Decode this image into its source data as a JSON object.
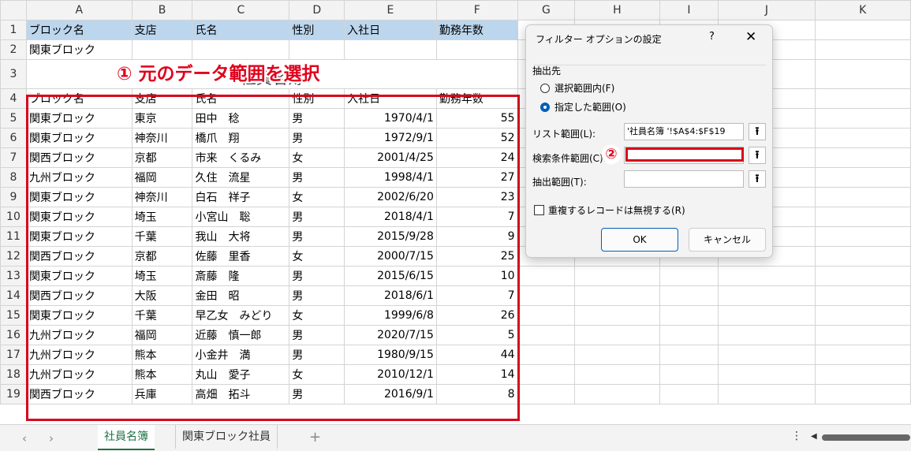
{
  "columns": [
    "A",
    "B",
    "C",
    "D",
    "E",
    "F",
    "G",
    "H",
    "I",
    "J",
    "K"
  ],
  "header_row1": [
    "ブロック名",
    "支店",
    "氏名",
    "性別",
    "入社日",
    "勤務年数"
  ],
  "row2_a": "関東ブロック",
  "title": "社員名簿",
  "header_row4": [
    "ブロック名",
    "支店",
    "氏名",
    "性別",
    "入社日",
    "勤務年数"
  ],
  "data_rows": [
    {
      "n": "5",
      "a": "関東ブロック",
      "b": "東京",
      "c": "田中　稔",
      "d": "男",
      "e": "1970/4/1",
      "f": "55"
    },
    {
      "n": "6",
      "a": "関東ブロック",
      "b": "神奈川",
      "c": "橋爪　翔",
      "d": "男",
      "e": "1972/9/1",
      "f": "52"
    },
    {
      "n": "7",
      "a": "関西ブロック",
      "b": "京都",
      "c": "市来　くるみ",
      "d": "女",
      "e": "2001/4/25",
      "f": "24"
    },
    {
      "n": "8",
      "a": "九州ブロック",
      "b": "福岡",
      "c": "久住　流星",
      "d": "男",
      "e": "1998/4/1",
      "f": "27"
    },
    {
      "n": "9",
      "a": "関東ブロック",
      "b": "神奈川",
      "c": "白石　祥子",
      "d": "女",
      "e": "2002/6/20",
      "f": "23"
    },
    {
      "n": "10",
      "a": "関東ブロック",
      "b": "埼玉",
      "c": "小宮山　聡",
      "d": "男",
      "e": "2018/4/1",
      "f": "7"
    },
    {
      "n": "11",
      "a": "関東ブロック",
      "b": "千葉",
      "c": "我山　大将",
      "d": "男",
      "e": "2015/9/28",
      "f": "9"
    },
    {
      "n": "12",
      "a": "関西ブロック",
      "b": "京都",
      "c": "佐藤　里香",
      "d": "女",
      "e": "2000/7/15",
      "f": "25"
    },
    {
      "n": "13",
      "a": "関東ブロック",
      "b": "埼玉",
      "c": "斎藤　隆",
      "d": "男",
      "e": "2015/6/15",
      "f": "10"
    },
    {
      "n": "14",
      "a": "関西ブロック",
      "b": "大阪",
      "c": "金田　昭",
      "d": "男",
      "e": "2018/6/1",
      "f": "7"
    },
    {
      "n": "15",
      "a": "関東ブロック",
      "b": "千葉",
      "c": "早乙女　みどり",
      "d": "女",
      "e": "1999/6/8",
      "f": "26"
    },
    {
      "n": "16",
      "a": "九州ブロック",
      "b": "福岡",
      "c": "近藤　慎一郎",
      "d": "男",
      "e": "2020/7/15",
      "f": "5"
    },
    {
      "n": "17",
      "a": "九州ブロック",
      "b": "熊本",
      "c": "小金井　満",
      "d": "男",
      "e": "1980/9/15",
      "f": "44"
    },
    {
      "n": "18",
      "a": "九州ブロック",
      "b": "熊本",
      "c": "丸山　愛子",
      "d": "女",
      "e": "2010/12/1",
      "f": "14"
    },
    {
      "n": "19",
      "a": "関西ブロック",
      "b": "兵庫",
      "c": "高畑　拓斗",
      "d": "男",
      "e": "2016/9/1",
      "f": "8"
    }
  ],
  "annotation1": "① 元のデータ範囲を選択",
  "annotation2": "②",
  "dialog": {
    "title": "フィルター オプションの設定",
    "help": "?",
    "close": "✕",
    "group_label": "抽出先",
    "radio1": "選択範囲内(F)",
    "radio2": "指定した範囲(O)",
    "list_range_label": "リスト範囲(L):",
    "list_range_value": "'社員名簿 '!$A$4:$F$19",
    "criteria_label": "検索条件範囲(C):",
    "criteria_value": "",
    "extract_label": "抽出範囲(T):",
    "extract_value": "",
    "unique_label": "重複するレコードは無視する(R)",
    "ok": "OK",
    "cancel": "キャンセル",
    "range_icon": "⭱"
  },
  "tabs": {
    "sheet1": "社員名簿",
    "sheet2": "関東ブロック社員",
    "add": "+",
    "prev": "‹",
    "next": "›",
    "menu": "⋮"
  }
}
